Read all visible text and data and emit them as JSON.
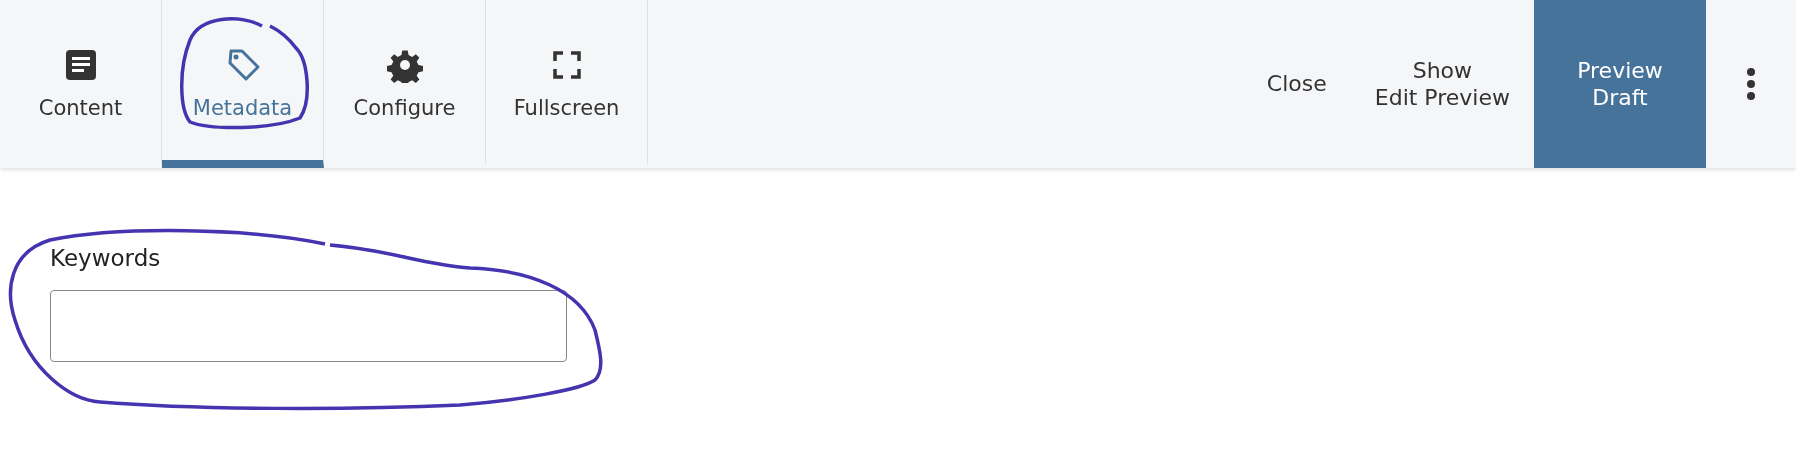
{
  "tabs": [
    {
      "label": "Content",
      "kind": "document",
      "selected": false
    },
    {
      "label": "Metadata",
      "kind": "tag",
      "selected": true
    },
    {
      "label": "Configure",
      "kind": "gear",
      "selected": false
    },
    {
      "label": "Fullscreen",
      "kind": "expand",
      "selected": false
    }
  ],
  "actions": [
    {
      "lines": [
        "Close"
      ],
      "kind": "plain"
    },
    {
      "lines": [
        "Show",
        "Edit Preview"
      ],
      "kind": "plain"
    },
    {
      "lines": [
        "Preview",
        "Draft"
      ],
      "kind": "primary"
    }
  ],
  "form": {
    "label": "Keywords"
  }
}
